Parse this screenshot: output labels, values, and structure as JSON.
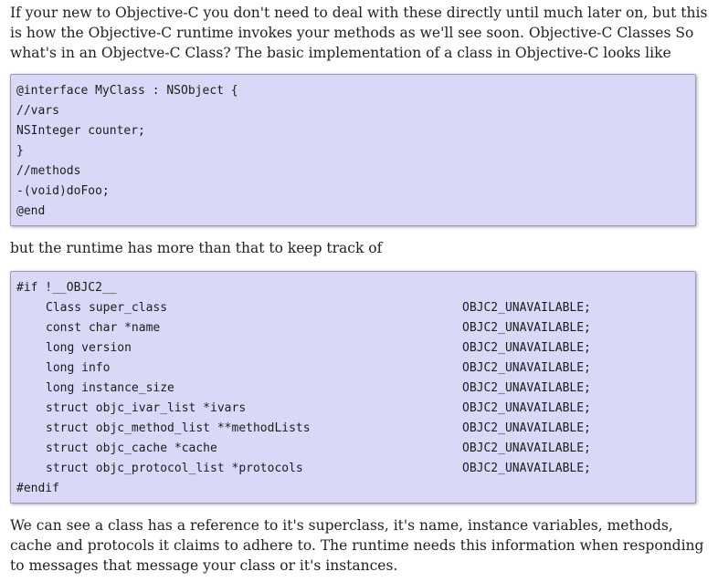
{
  "paragraph_intro": "If your new to Objective-C you don't need to deal with these directly until much later on, but this is how the Objective-C runtime invokes your methods as we'll see soon. Objective-C Classes So what's in an Objectve-C Class? The basic implementation of a class in Objective-C looks like",
  "code_block_1": {
    "lines": [
      "@interface MyClass : NSObject {",
      "//vars",
      "NSInteger counter;",
      "}",
      "//methods",
      "-(void)doFoo;",
      "@end"
    ]
  },
  "paragraph_middle": "but the runtime has more than that to keep track of",
  "code_block_2": {
    "header": "#if !__OBJC2__",
    "rows": [
      {
        "decl": "Class super_class",
        "attr": "OBJC2_UNAVAILABLE;"
      },
      {
        "decl": "const char *name",
        "attr": "OBJC2_UNAVAILABLE;"
      },
      {
        "decl": "long version",
        "attr": "OBJC2_UNAVAILABLE;"
      },
      {
        "decl": "long info",
        "attr": "OBJC2_UNAVAILABLE;"
      },
      {
        "decl": "long instance_size",
        "attr": "OBJC2_UNAVAILABLE;"
      },
      {
        "decl": "struct objc_ivar_list *ivars",
        "attr": "OBJC2_UNAVAILABLE;"
      },
      {
        "decl": "struct objc_method_list **methodLists",
        "attr": "OBJC2_UNAVAILABLE;"
      },
      {
        "decl": "struct objc_cache *cache",
        "attr": "OBJC2_UNAVAILABLE;"
      },
      {
        "decl": "struct objc_protocol_list *protocols",
        "attr": "OBJC2_UNAVAILABLE;"
      }
    ],
    "footer": "#endif"
  },
  "paragraph_closing": "We can see a class has a reference to it's superclass, it's name, instance variables, methods, cache and protocols it claims to adhere to. The runtime needs this information when responding to messages that message your class or it's instances."
}
